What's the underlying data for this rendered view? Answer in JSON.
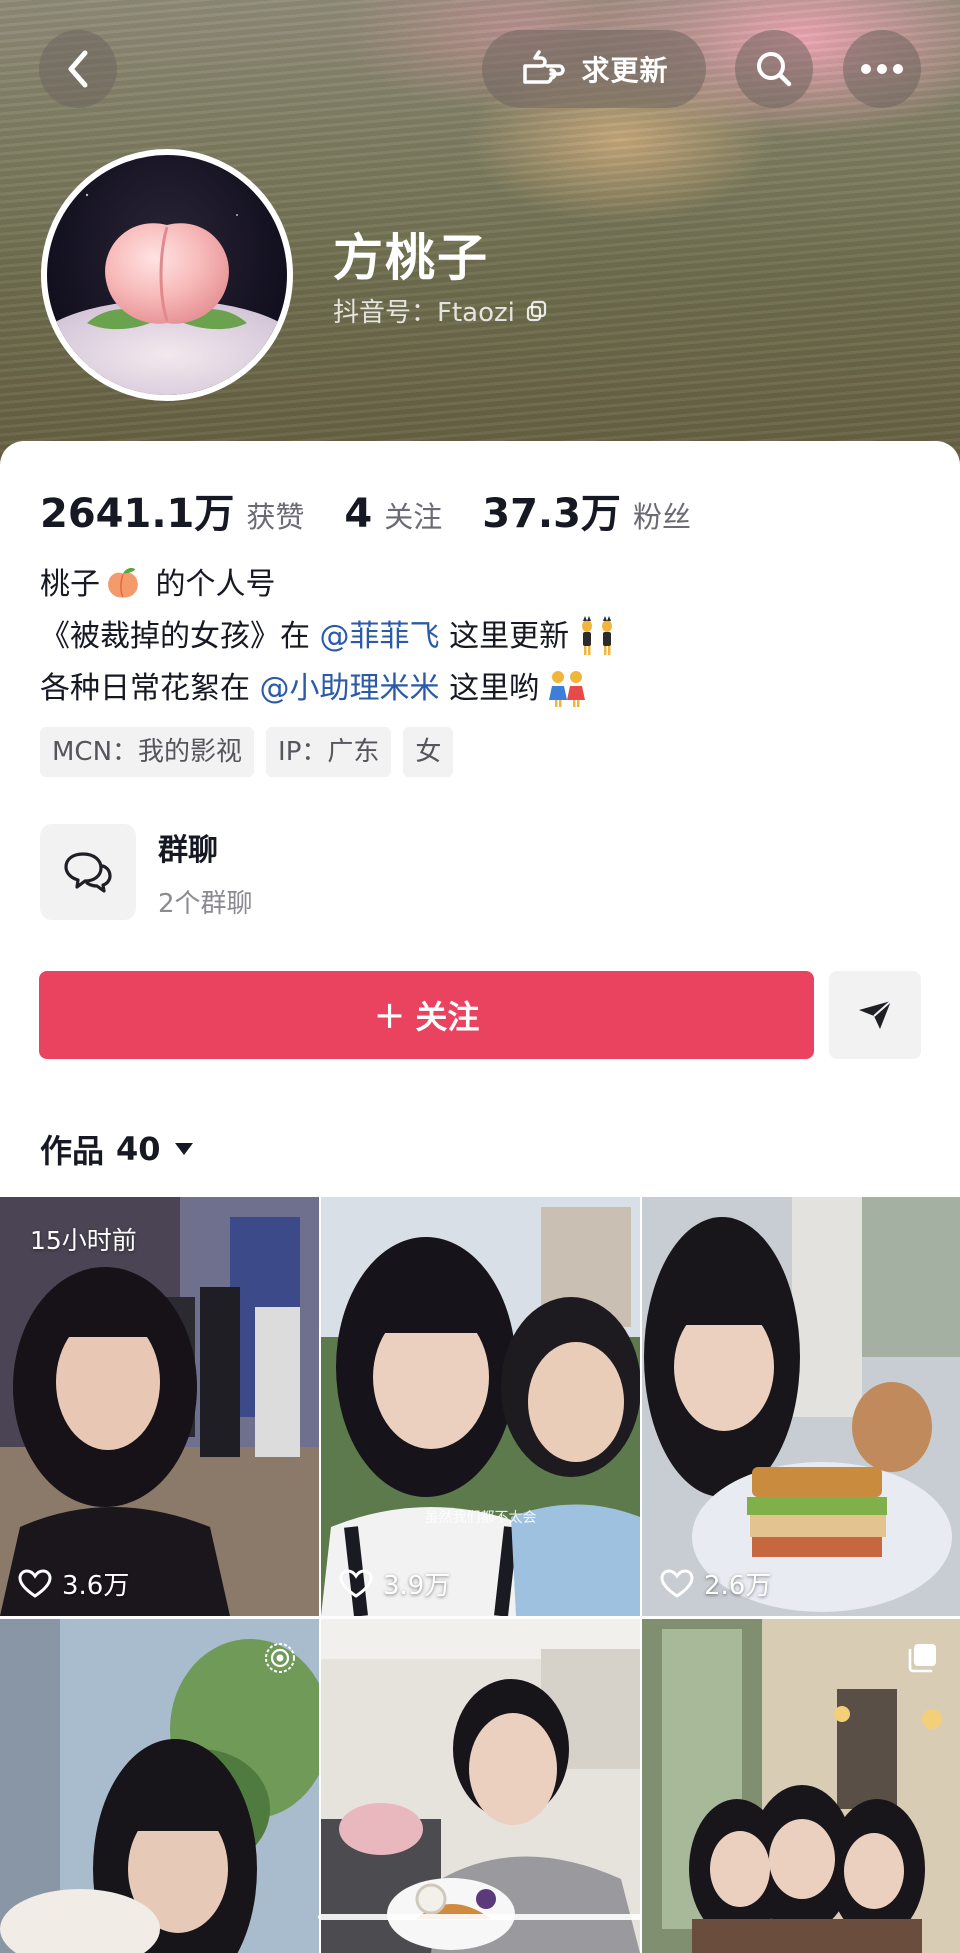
{
  "header": {
    "request_update_label": "求更新",
    "name": "方桃子",
    "douyin_id": "抖音号：Ftaozi"
  },
  "stats": [
    {
      "value": "2641.1万",
      "label": "获赞"
    },
    {
      "value": "4",
      "label": "关注"
    },
    {
      "value": "37.3万",
      "label": "粉丝"
    }
  ],
  "bio": {
    "line1_a": "桃子",
    "line1_b": "的个人号",
    "line2_a": "《被裁掉的女孩》在",
    "line2_mention": "@菲菲飞",
    "line2_b": "这里更新",
    "line3_a": "各种日常花絮在",
    "line3_mention": "@小助理米米",
    "line3_b": "这里哟"
  },
  "tags": [
    "MCN：我的影视",
    "IP：广东",
    "女"
  ],
  "group_chat": {
    "title": "群聊",
    "subtitle": "2个群聊"
  },
  "follow_label": "关注",
  "follow_plus": "+",
  "works": {
    "label": "作品",
    "count": "40"
  },
  "videos": [
    {
      "time": "15小时前",
      "likes": "3.6万"
    },
    {
      "likes": "3.9万",
      "caption": "虽然我们都不太会"
    },
    {
      "likes": "2.6万"
    },
    {},
    {},
    {}
  ],
  "colors": {
    "follow": "#ea4360",
    "mention": "#2b5aa8"
  }
}
